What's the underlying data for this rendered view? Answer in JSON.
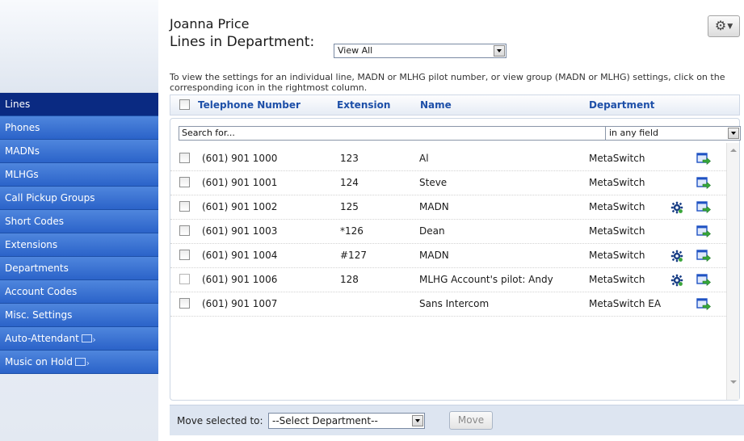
{
  "header": {
    "user_name": "Joanna Price",
    "lines_title": "Lines in Department:",
    "department_filter": "View All",
    "instructions": "To view the settings for an individual line, MADN or MLHG pilot number, or view group (MADN or MLHG) settings, click on the corresponding icon in the rightmost column."
  },
  "nav": {
    "items": [
      {
        "label": "Lines",
        "active": true
      },
      {
        "label": "Phones"
      },
      {
        "label": "MADNs"
      },
      {
        "label": "MLHGs"
      },
      {
        "label": "Call Pickup Groups"
      },
      {
        "label": "Short Codes"
      },
      {
        "label": "Extensions"
      },
      {
        "label": "Departments"
      },
      {
        "label": "Account Codes"
      },
      {
        "label": "Misc. Settings"
      },
      {
        "label": "Auto-Attendant",
        "external": true
      },
      {
        "label": "Music on Hold",
        "external": true
      }
    ]
  },
  "table": {
    "columns": {
      "telephone": "Telephone Number",
      "extension": "Extension",
      "name": "Name",
      "department": "Department"
    },
    "search_placeholder": "Search for...",
    "search_field": "in any field",
    "rows": [
      {
        "tel": "(601) 901 1000",
        "ext": "123",
        "name": "Al",
        "dept": "MetaSwitch",
        "group_icon": false
      },
      {
        "tel": "(601) 901 1001",
        "ext": "124",
        "name": "Steve",
        "dept": "MetaSwitch",
        "group_icon": false
      },
      {
        "tel": "(601) 901 1002",
        "ext": "125",
        "name": "MADN",
        "dept": "MetaSwitch",
        "group_icon": true
      },
      {
        "tel": "(601) 901 1003",
        "ext": "*126",
        "name": "Dean",
        "dept": "MetaSwitch",
        "group_icon": false
      },
      {
        "tel": "(601) 901 1004",
        "ext": "#127",
        "name": "MADN",
        "dept": "MetaSwitch",
        "group_icon": true
      },
      {
        "tel": "(601) 901 1006",
        "ext": "128",
        "name": "MLHG Account's pilot: Andy",
        "dept": "MetaSwitch",
        "group_icon": true
      },
      {
        "tel": "(601) 901 1007",
        "ext": "",
        "name": "Sans Intercom",
        "dept": "MetaSwitch EA",
        "group_icon": false
      }
    ]
  },
  "footer": {
    "move_label": "Move selected to:",
    "move_select": "--Select Department--",
    "move_button": "Move"
  },
  "icons": {
    "settings_menu": "gear-icon",
    "row_group_settings": "gear-icon",
    "row_open": "go-to-icon",
    "external": "external-link-icon"
  },
  "colors": {
    "nav_blue": "#2b63c9",
    "nav_active": "#0a2a82",
    "header_text": "#1d4fa8"
  }
}
